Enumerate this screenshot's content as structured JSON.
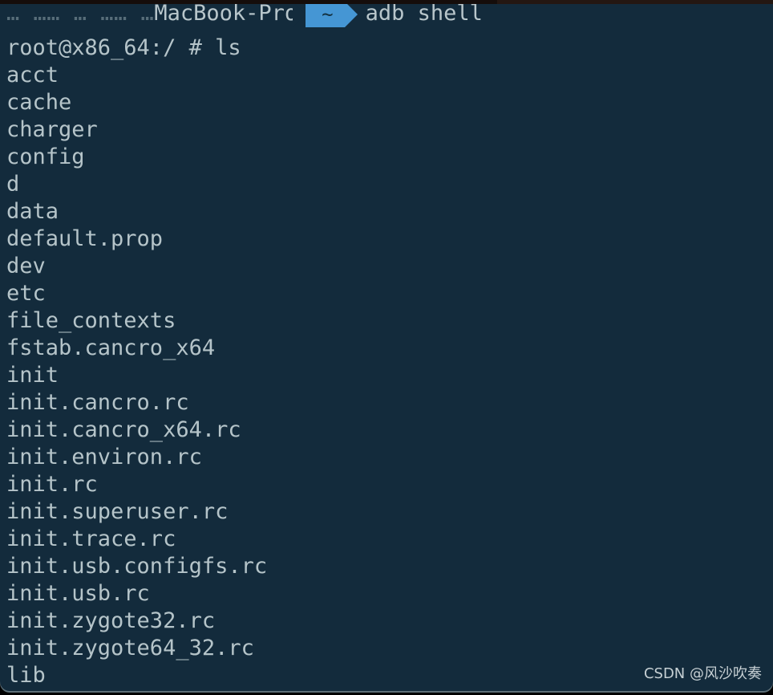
{
  "window": {
    "background_color": "#132b3c",
    "text_color": "#b5c4c9",
    "accent_color": "#4596d4",
    "top_strip_color": "#150d0b"
  },
  "prompt": {
    "clipped_prefix": "… …… … …… …",
    "host": "MacBook-Pro",
    "path_badge": "~",
    "command": "adb shell"
  },
  "shell": {
    "command_line": "root@x86_64:/ # ls",
    "output_lines": [
      "acct",
      "cache",
      "charger",
      "config",
      "d",
      "data",
      "default.prop",
      "dev",
      "etc",
      "file_contexts",
      "fstab.cancro_x64",
      "init",
      "init.cancro.rc",
      "init.cancro_x64.rc",
      "init.environ.rc",
      "init.rc",
      "init.superuser.rc",
      "init.trace.rc",
      "init.usb.configfs.rc",
      "init.usb.rc",
      "init.zygote32.rc",
      "init.zygote64_32.rc",
      "lib"
    ]
  },
  "watermark": {
    "text": "CSDN @风沙吹奏"
  }
}
